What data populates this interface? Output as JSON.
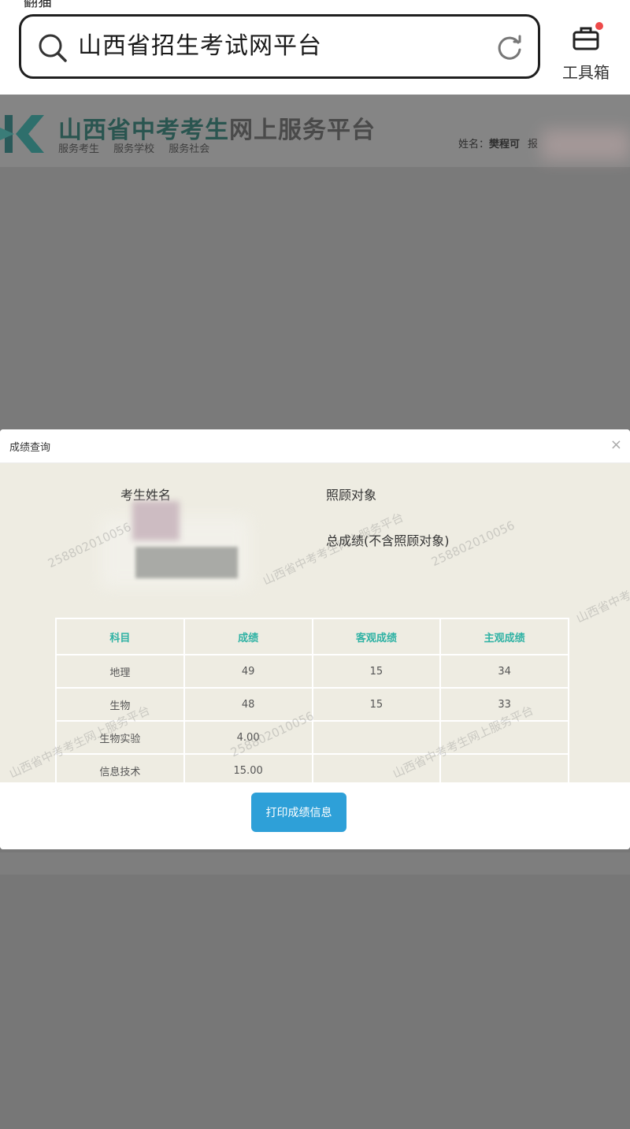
{
  "browser": {
    "status_peek": "翻猫",
    "search_text": "山西省招生考试网平台",
    "toolbox_label": "工具箱"
  },
  "site": {
    "title_main": "山西省中考考生",
    "title_rest": "网上服务平台",
    "nav": "服务考生   服务学校   服务社会",
    "user_label": "姓名：",
    "user_name": "樊程可",
    "user_extra": "报"
  },
  "dialog": {
    "title": "成绩查询",
    "close_symbol": "×",
    "labels": {
      "student_name": "考生姓名",
      "care_object": "照顾对象",
      "total_score": "总成绩(不含照顾对象)"
    },
    "table": {
      "headers": [
        "科目",
        "成绩",
        "客观成绩",
        "主观成绩"
      ],
      "rows": [
        [
          "地理",
          "49",
          "15",
          "34"
        ],
        [
          "生物",
          "48",
          "15",
          "33"
        ],
        [
          "生物实验",
          "4.00",
          "",
          ""
        ],
        [
          "信息技术",
          "15.00",
          "",
          ""
        ]
      ]
    },
    "watermarks": {
      "id_number": "258802010056",
      "platform": "山西省中考考生网上服务平台"
    },
    "print_label": "打印成绩信息"
  },
  "colors": {
    "accent_teal": "#2fb2a4",
    "button_blue": "#2ea0d8",
    "overlay_gray": "#7a7a7a"
  }
}
